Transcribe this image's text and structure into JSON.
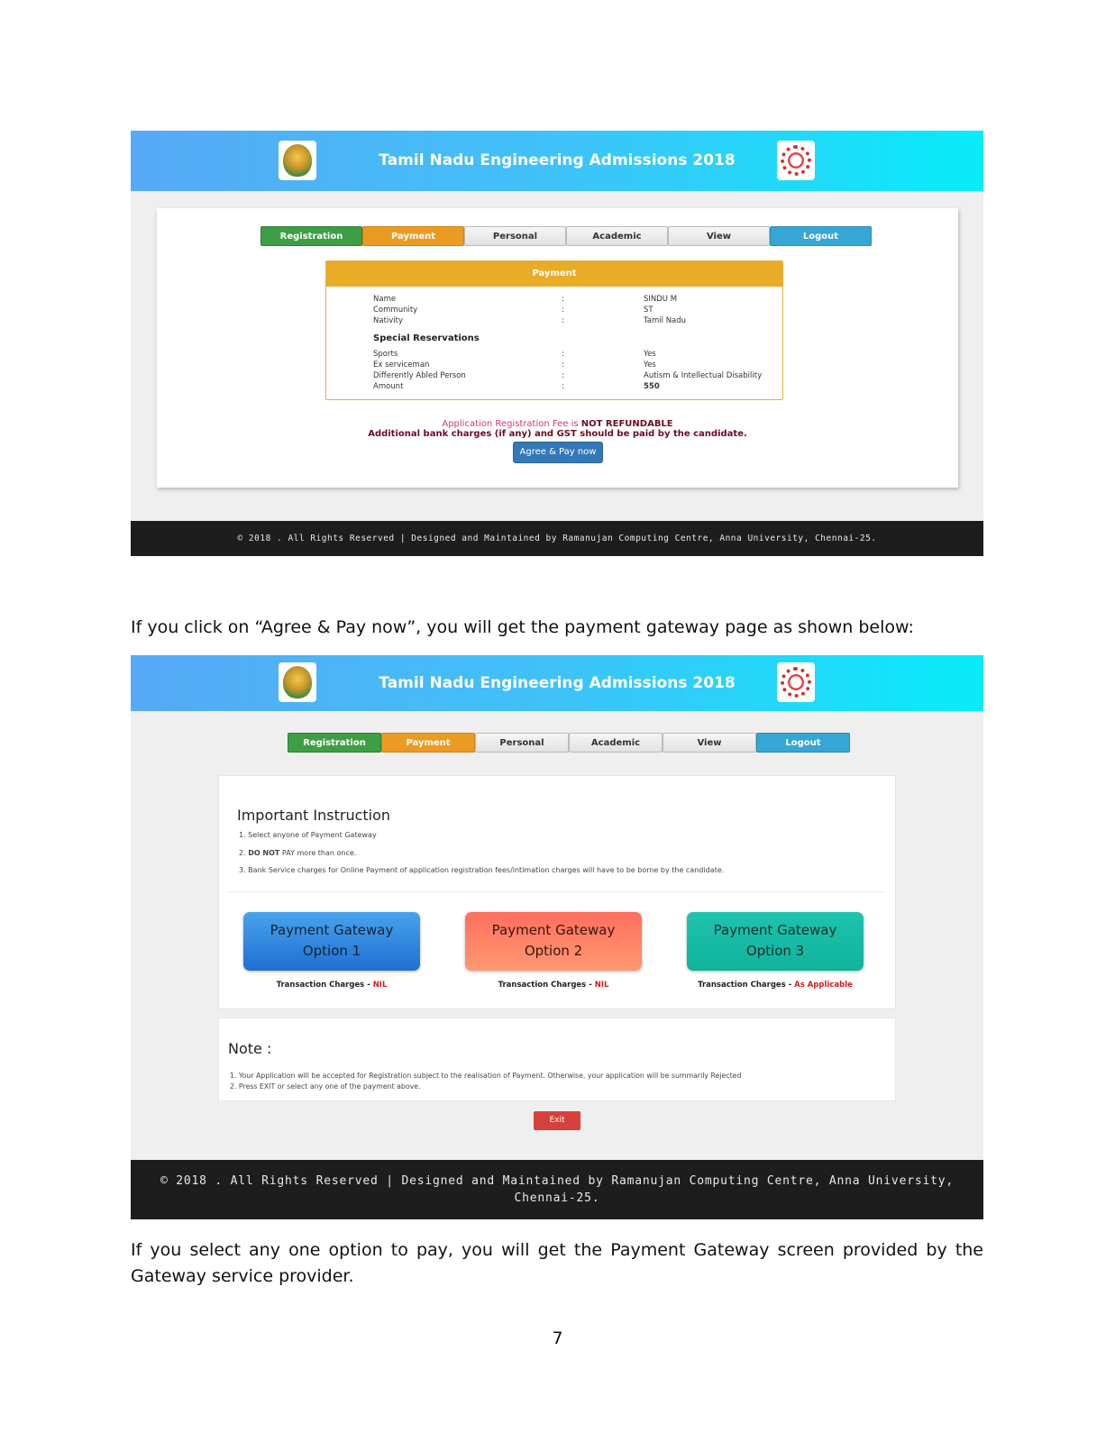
{
  "screen1": {
    "banner_title": "Tamil Nadu Engineering Admissions 2018",
    "tabs": [
      "Registration",
      "Payment",
      "Personal",
      "Academic",
      "View",
      "Logout"
    ],
    "payment_title": "Payment",
    "fields": [
      {
        "label": "Name",
        "value": "SINDU M"
      },
      {
        "label": "Community",
        "value": "ST"
      },
      {
        "label": "Nativity",
        "value": "Tamil Nadu"
      }
    ],
    "special_title": "Special Reservations",
    "special_fields": [
      {
        "label": "Sports",
        "value": "Yes"
      },
      {
        "label": "Ex serviceman",
        "value": "Yes"
      },
      {
        "label": "Differently Abled Person",
        "value": "Autism & Intellectual Disability"
      },
      {
        "label": "Amount",
        "value": "550"
      }
    ],
    "fee_pink": "Application Registration Fee is ",
    "fee_bold": "NOT REFUNDABLE",
    "fee_line2": "Additional bank charges (if any) and GST should be paid by the candidate.",
    "agree_button": "Agree & Pay now",
    "footer": "© 2018 . All Rights Reserved | Designed and Maintained by Ramanujan Computing Centre, Anna University, Chennai-25."
  },
  "text1": "If you click on “Agree & Pay now”, you will get the payment gateway page as shown below:",
  "screen2": {
    "banner_title": "Tamil Nadu Engineering Admissions 2018",
    "tabs": [
      "Registration",
      "Payment",
      "Personal",
      "Academic",
      "View",
      "Logout"
    ],
    "instr_title": "Important Instruction",
    "instr_1": "1. Select anyone of Payment Gateway",
    "instr_2_pre": "2. ",
    "instr_2_bold": "DO NOT",
    "instr_2_post": " PAY more than once.",
    "instr_3": "3. Bank Service charges for Online Payment of application registration fees/intimation charges will have to be borne by the candidate.",
    "gateways": [
      {
        "line1": "Payment Gateway",
        "line2": "Option 1",
        "tc_label": "Transaction Charges - ",
        "tc_value": "NIL"
      },
      {
        "line1": "Payment Gateway",
        "line2": "Option 2",
        "tc_label": "Transaction Charges - ",
        "tc_value": "NIL"
      },
      {
        "line1": "Payment Gateway",
        "line2": "Option 3",
        "tc_label": "Transaction Charges - ",
        "tc_value": "As Applicable"
      }
    ],
    "note_title": "Note :",
    "note_1": "1. Your Application will be accepted for Registration subject to the realisation of Payment. Otherwise, your application will be summarily Rejected",
    "note_2": "2. Press EXIT or select any one of the payment above.",
    "exit_button": "Exit",
    "footer_line1": "© 2018 . All Rights Reserved | Designed and Maintained by Ramanujan Computing Centre, Anna University,",
    "footer_line2": "Chennai-25."
  },
  "text2": "If you select any one option to pay, you will get the Payment Gateway screen provided by the Gateway service provider.",
  "page_number": "7",
  "icons": {
    "left_logo": "tamil-nadu-emblem-icon",
    "right_logo": "anna-university-gear-icon"
  }
}
